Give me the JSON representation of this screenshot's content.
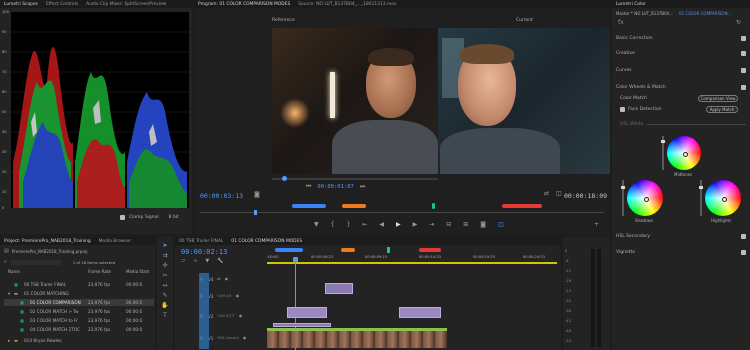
{
  "scopes_panel": {
    "tabs": [
      "Lumetri Scopes",
      "Effect Controls",
      "Audio Clip Mixer: SplitScreenPreview"
    ],
    "scale_labels": [
      "100",
      "90",
      "80",
      "70",
      "60",
      "50",
      "40",
      "30",
      "20",
      "10",
      "0"
    ],
    "clamp_signal_label": "Clamp Signal",
    "bit_depth_label": "8 bit"
  },
  "program_monitor": {
    "tabs": [
      "Program: 01 COLOR COMPARISON MODES",
      "Source: NO LUT_B137B04_..._18011313.mov"
    ],
    "reference_label": "Reference",
    "current_label": "Current",
    "ref_timecode": "00:00:01:07",
    "left_timecode": "00:00:03:13",
    "right_timecode": "00:00:18:09"
  },
  "lumetri_color": {
    "title": "Lumetri Color",
    "source_label": "Master * NO LUT_B137B04...",
    "sequence_label": "01 COLOR COMPARISON...",
    "sections": [
      "Basic Correction",
      "Creative",
      "Curves",
      "Color Wheels & Match"
    ],
    "color_match_label": "Color Match",
    "comparison_view_label": "Comparison View",
    "face_detection_label": "Face Detection",
    "apply_match_label": "Apply Match",
    "hsl_white_label": "HSL White",
    "wheel_labels": [
      "Midtones",
      "Shadows",
      "Highlights"
    ],
    "bottom_sections": [
      "HSL Secondary",
      "Vignette"
    ]
  },
  "project_panel": {
    "tabs": [
      "Project: PremierePro_NAB2018_Training",
      "Media Browser"
    ],
    "path_label": "PremierePro_NAB2018_Training.prproj",
    "selection_count": "1 of 16 items selected",
    "columns": [
      "Name",
      "Frame Rate",
      "Media Start"
    ],
    "rows": [
      {
        "name": "00 TSB Trailer FINAL",
        "rate": "23,976 fps",
        "start": "00:00:0"
      },
      {
        "name": "01 COLOR MATCHING",
        "rate": "",
        "start": ""
      },
      {
        "name": "01 COLOR COMPARISON",
        "rate": "23,976 fps",
        "start": "00:00:0"
      },
      {
        "name": "02 COLOR MATCH > Tw",
        "rate": "23,976 fps",
        "start": "00:00:0"
      },
      {
        "name": "03 COLOR MATCH to Fr",
        "rate": "23,976 fps",
        "start": "00:00:0"
      },
      {
        "name": "04 COLOR MATCH 2TOC",
        "rate": "23,976 fps",
        "start": "00:00:0"
      },
      {
        "name": "014 Bryan Rowles",
        "rate": "",
        "start": ""
      }
    ]
  },
  "timeline": {
    "tabs": [
      "00 TSB Trailer FINAL",
      "01 COLOR COMPARISON MODES"
    ],
    "timecode": "00:00:02:13",
    "ruler_labels": [
      ":00:00",
      "00:00:04:23",
      "00:00:09:23",
      "00:00:14:23",
      "00:00:19:23",
      "00:00:24:23"
    ],
    "tracks": [
      {
        "id": "V4",
        "name": ""
      },
      {
        "id": "V3",
        "name": "CAM A/S"
      },
      {
        "id": "V2",
        "name": "CAM A/T/T"
      },
      {
        "id": "V1",
        "name": "RED Camera"
      }
    ]
  },
  "audio_meter": {
    "ticks": [
      "0",
      "-6",
      "-12",
      "-18",
      "-24",
      "-30",
      "-36",
      "-42",
      "-48",
      "-54"
    ]
  },
  "colors": {
    "accent_blue": "#4f9cff",
    "marker_blue": "#3b82f6",
    "marker_orange": "#f07a1a",
    "marker_red": "#e53935",
    "marker_green": "#19c39c",
    "clip_violet": "#8a7ab0"
  }
}
